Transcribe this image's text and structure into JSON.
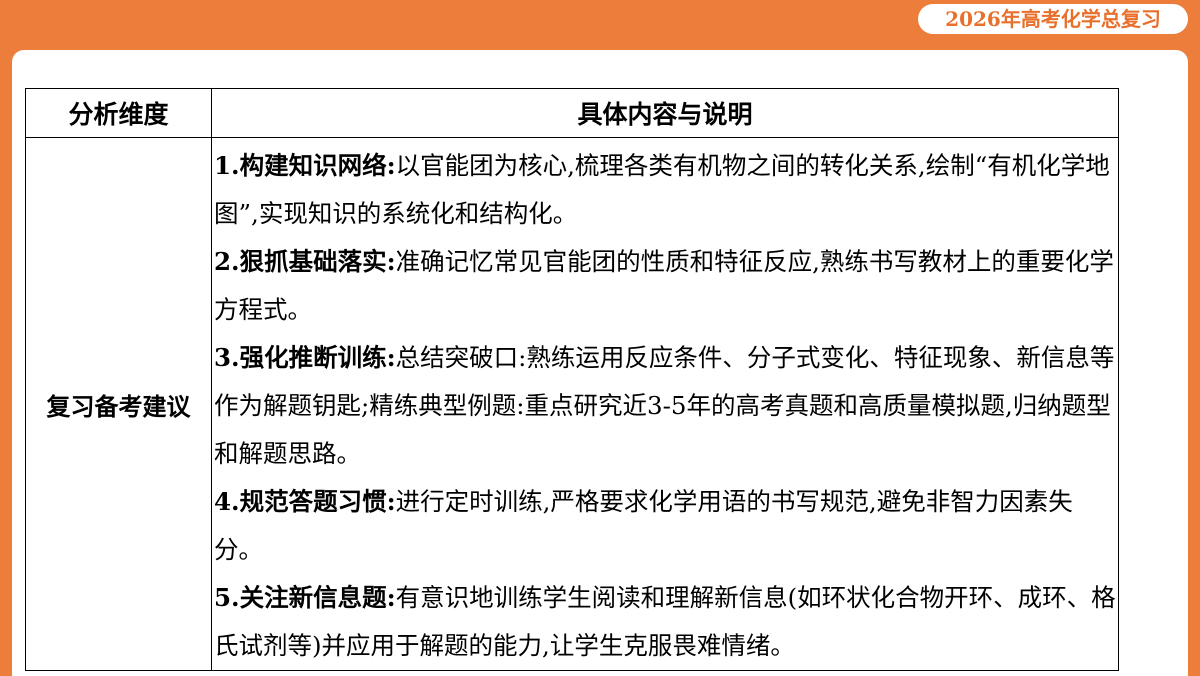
{
  "header": {
    "badge": "2026年高考化学总复习"
  },
  "table": {
    "headers": [
      "分析维度",
      "具体内容与说明"
    ],
    "row_label": "复习备考建议",
    "items": [
      {
        "label": "1.构建知识网络:",
        "text": "以官能团为核心,梳理各类有机物之间的转化关系,绘制“有机化学地图”,实现知识的系统化和结构化。"
      },
      {
        "label": "2.狠抓基础落实:",
        "text": "准确记忆常见官能团的性质和特征反应,熟练书写教材上的重要化学方程式。"
      },
      {
        "label": "3.强化推断训练:",
        "text": "总结突破口:熟练运用反应条件、分子式变化、特征现象、新信息等作为解题钥匙;精练典型例题:重点研究近3-5年的高考真题和高质量模拟题,归纳题型和解题思路。"
      },
      {
        "label": "4.规范答题习惯:",
        "text": "进行定时训练,严格要求化学用语的书写规范,避免非智力因素失分。"
      },
      {
        "label": "5.关注新信息题:",
        "text": "有意识地训练学生阅读和理解新信息(如环状化合物开环、成环、格氏试剂等)并应用于解题的能力,让学生克服畏难情绪。"
      }
    ]
  }
}
